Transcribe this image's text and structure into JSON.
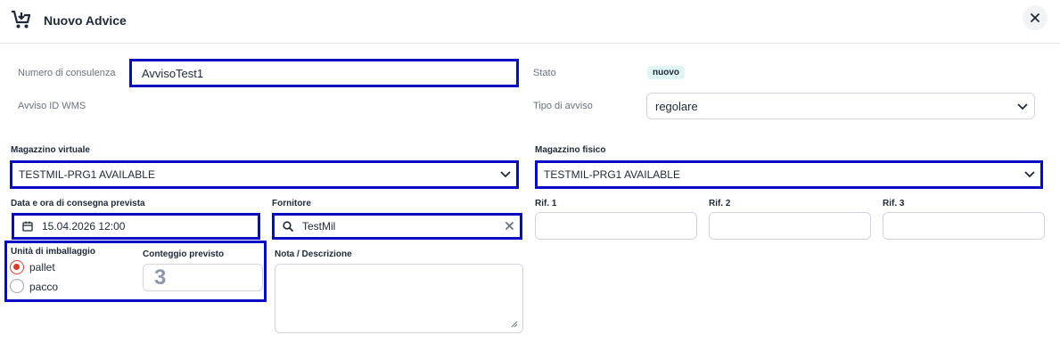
{
  "header": {
    "title": "Nuovo Advice",
    "icon": "cart-download-icon",
    "close_icon": "close-icon"
  },
  "form": {
    "advice_number": {
      "label": "Numero di consulenza",
      "value": "AvvisoTest1"
    },
    "wms_id": {
      "label": "Avviso ID WMS"
    },
    "status": {
      "label": "Stato",
      "value": "nuovo"
    },
    "advice_type": {
      "label": "Tipo di avviso",
      "value": "regolare"
    },
    "virtual_warehouse": {
      "label": "Magazzino virtuale",
      "value": "TESTMIL-PRG1 AVAILABLE"
    },
    "physical_warehouse": {
      "label": "Magazzino fisico",
      "value": "TESTMIL-PRG1 AVAILABLE"
    },
    "delivery_date": {
      "label": "Data e ora di consegna prevista",
      "value": "15.04.2026 12:00"
    },
    "supplier": {
      "label": "Fornitore",
      "value": "TestMil"
    },
    "ref1": {
      "label": "Rif. 1",
      "value": ""
    },
    "ref2": {
      "label": "Rif. 2",
      "value": ""
    },
    "ref3": {
      "label": "Rif. 3",
      "value": ""
    },
    "packaging_unit": {
      "label": "Unità di imballaggio",
      "options": [
        "pallet",
        "pacco"
      ],
      "selected": "pallet"
    },
    "expected_count": {
      "label": "Conteggio previsto",
      "value": "3"
    },
    "note": {
      "label": "Nota / Descrizione",
      "value": ""
    }
  },
  "colors": {
    "highlight": "#0a0ac2",
    "radio_selected": "#d93c2b",
    "badge_bg": "#dff5f5"
  }
}
